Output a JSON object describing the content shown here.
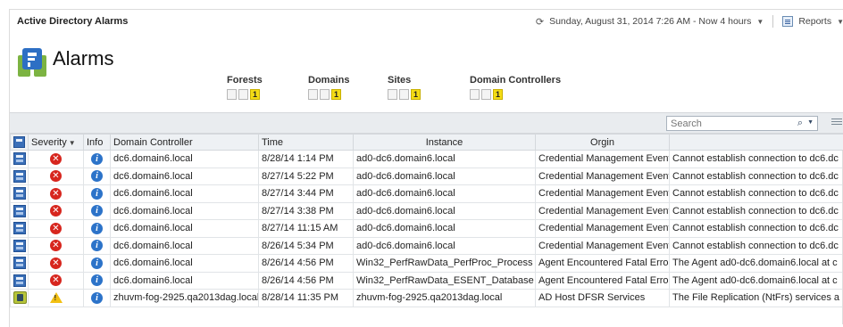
{
  "header": {
    "panel_title": "Active Directory Alarms",
    "time_range": "Sunday, August 31, 2014 7:26 AM - Now 4 hours",
    "reports_label": "Reports"
  },
  "page": {
    "heading": "Alarms"
  },
  "filters": [
    {
      "label": "Forests",
      "boxes": [
        "",
        "",
        "1"
      ]
    },
    {
      "label": "Domains",
      "boxes": [
        "",
        "",
        "1"
      ]
    },
    {
      "label": "Sites",
      "boxes": [
        "",
        "",
        "1"
      ]
    },
    {
      "label": "Domain Controllers",
      "boxes": [
        "",
        "",
        "1"
      ]
    }
  ],
  "search": {
    "placeholder": "Search"
  },
  "table": {
    "columns": {
      "severity": "Severity",
      "info": "Info",
      "domain_controller": "Domain Controller",
      "time": "Time",
      "instance": "Instance",
      "origin": "Orgin"
    },
    "rows": [
      {
        "type_icon": "ad-icon",
        "severity": "error",
        "dc": "dc6.domain6.local",
        "time": "8/28/14 1:14 PM",
        "instance": "ad0-dc6.domain6.local",
        "origin": "Credential Management Event",
        "message": "Cannot establish connection to dc6.dc"
      },
      {
        "type_icon": "ad-icon",
        "severity": "error",
        "dc": "dc6.domain6.local",
        "time": "8/27/14 5:22 PM",
        "instance": "ad0-dc6.domain6.local",
        "origin": "Credential Management Event",
        "message": "Cannot establish connection to dc6.dc"
      },
      {
        "type_icon": "ad-icon",
        "severity": "error",
        "dc": "dc6.domain6.local",
        "time": "8/27/14 3:44 PM",
        "instance": "ad0-dc6.domain6.local",
        "origin": "Credential Management Event",
        "message": "Cannot establish connection to dc6.dc"
      },
      {
        "type_icon": "ad-icon",
        "severity": "error",
        "dc": "dc6.domain6.local",
        "time": "8/27/14 3:38 PM",
        "instance": "ad0-dc6.domain6.local",
        "origin": "Credential Management Event",
        "message": "Cannot establish connection to dc6.dc"
      },
      {
        "type_icon": "ad-icon",
        "severity": "error",
        "dc": "dc6.domain6.local",
        "time": "8/27/14 11:15 AM",
        "instance": "ad0-dc6.domain6.local",
        "origin": "Credential Management Event",
        "message": "Cannot establish connection to dc6.dc"
      },
      {
        "type_icon": "ad-icon",
        "severity": "error",
        "dc": "dc6.domain6.local",
        "time": "8/26/14 5:34 PM",
        "instance": "ad0-dc6.domain6.local",
        "origin": "Credential Management Event",
        "message": "Cannot establish connection to dc6.dc"
      },
      {
        "type_icon": "ad-icon",
        "severity": "error",
        "dc": "dc6.domain6.local",
        "time": "8/26/14 4:56 PM",
        "instance": "Win32_PerfRawData_PerfProc_Process",
        "origin": "Agent Encountered Fatal Error",
        "message": "The Agent ad0-dc6.domain6.local at c"
      },
      {
        "type_icon": "ad-icon",
        "severity": "error",
        "dc": "dc6.domain6.local",
        "time": "8/26/14 4:56 PM",
        "instance": "Win32_PerfRawData_ESENT_Database",
        "origin": "Agent Encountered Fatal Error",
        "message": "The Agent ad0-dc6.domain6.local at c"
      },
      {
        "type_icon": "host-icon",
        "severity": "warning",
        "dc": "zhuvm-fog-2925.qa2013dag.local",
        "time": "8/28/14 11:35 PM",
        "instance": "zhuvm-fog-2925.qa2013dag.local",
        "origin": "AD Host DFSR Services",
        "message": "The File Replication (NtFrs) services a"
      }
    ]
  },
  "icons": {
    "error_symbol": "✕",
    "warning_symbol": "!",
    "info_symbol": "i"
  },
  "colors": {
    "error": "#d7261e",
    "warning": "#f2c012",
    "info": "#2c73c9",
    "filter_active": "#f4dc15"
  }
}
